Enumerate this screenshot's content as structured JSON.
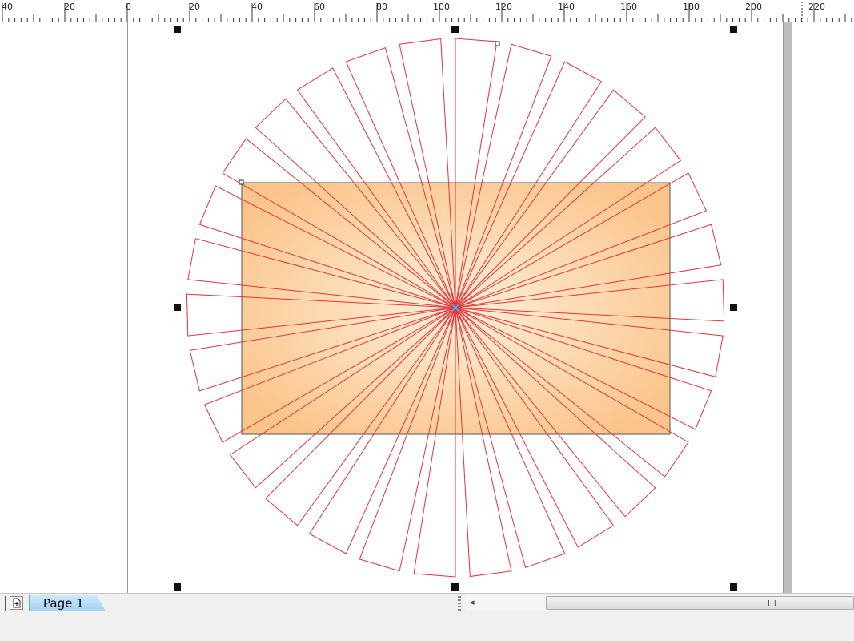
{
  "ruler": {
    "labels": [
      {
        "text": "40"
      },
      {
        "text": "20"
      },
      {
        "text": "0"
      },
      {
        "text": "20"
      },
      {
        "text": "40"
      },
      {
        "text": "60"
      },
      {
        "text": "80"
      },
      {
        "text": "100"
      },
      {
        "text": "120"
      },
      {
        "text": "140"
      },
      {
        "text": "160"
      },
      {
        "text": "180"
      },
      {
        "text": "200"
      },
      {
        "text": "220"
      }
    ]
  },
  "document": {
    "rectangle_fill_center": "#fff0da",
    "rectangle_fill_edge": "#fbc48a",
    "ray_color": "#e8333b",
    "ray_count": 30
  },
  "pages": {
    "tabs": [
      {
        "label": "Page 1"
      }
    ]
  },
  "scrollbar": {
    "grip_glyph": "III",
    "left_arrow": "◂"
  }
}
